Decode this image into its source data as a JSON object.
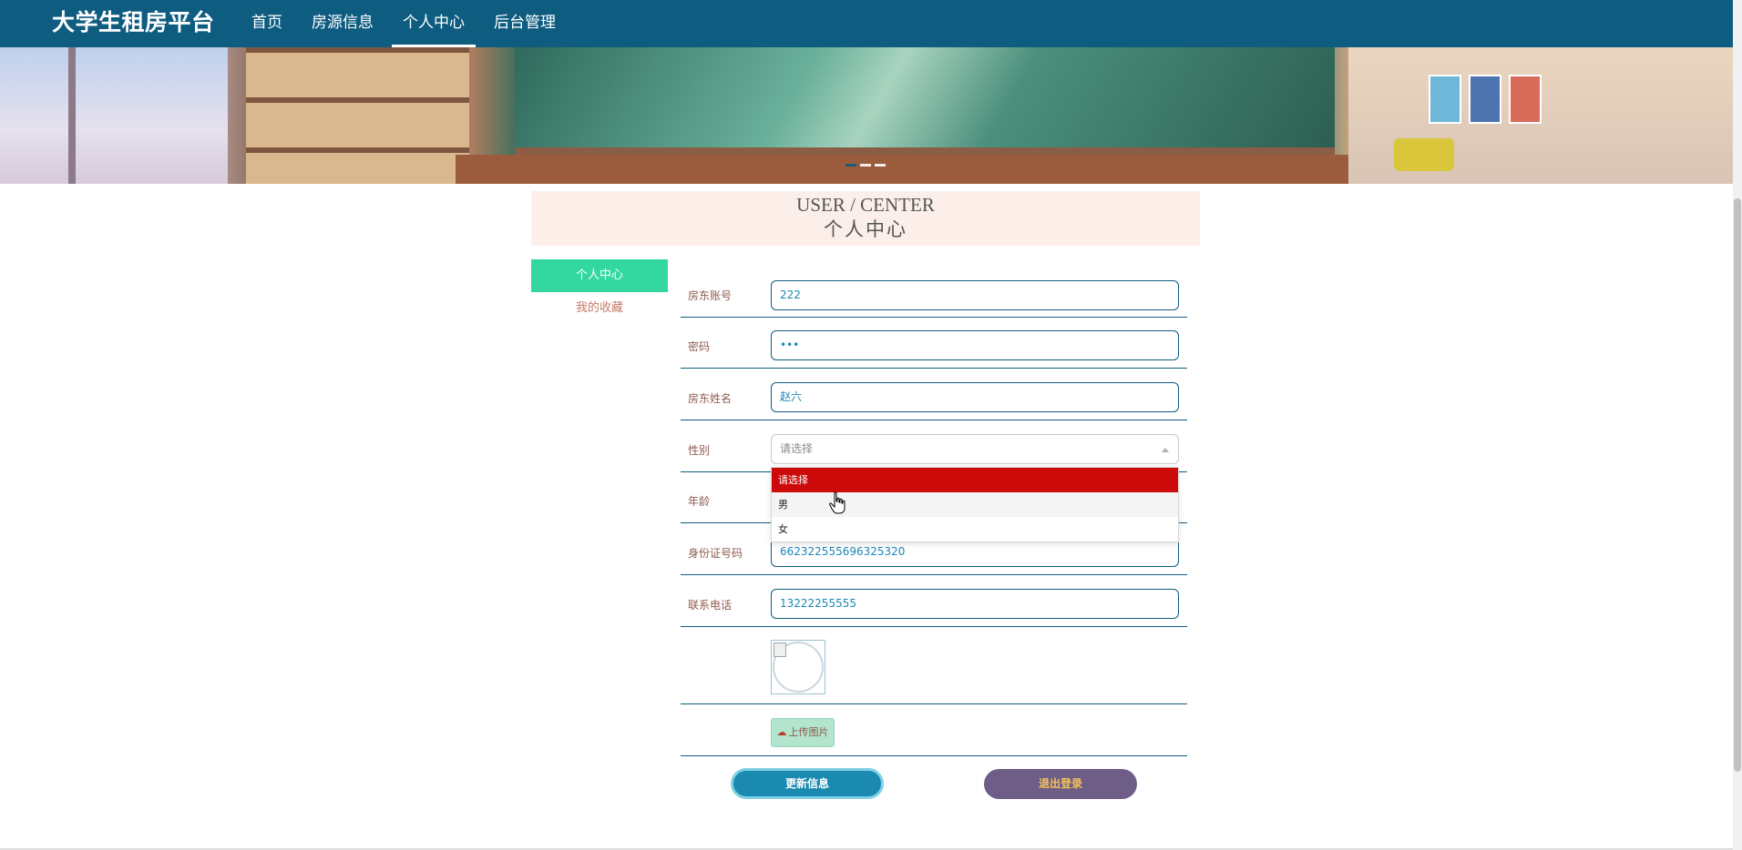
{
  "nav": {
    "brand": "大学生租房平台",
    "items": [
      {
        "label": "首页"
      },
      {
        "label": "房源信息"
      },
      {
        "label": "个人中心"
      },
      {
        "label": "后台管理"
      }
    ],
    "active_item": "个人中心",
    "bg_color": "#0e5c80"
  },
  "banner": {
    "slides_count": 3,
    "active_slide": 1
  },
  "header": {
    "title_en": "USER / CENTER",
    "title_cn": "个人中心"
  },
  "side_menu": {
    "items": [
      {
        "label": "个人中心"
      },
      {
        "label": "我的收藏"
      }
    ],
    "active_color": "#33d8a0"
  },
  "form": {
    "account": {
      "label": "房东账号",
      "value": "222"
    },
    "password": {
      "label": "密码",
      "value": "•••"
    },
    "name": {
      "label": "房东姓名",
      "value": "赵六"
    },
    "gender": {
      "label": "性别",
      "placeholder": "请选择",
      "options": [
        "请选择",
        "男",
        "女"
      ],
      "highlighted_option": "请选择"
    },
    "age": {
      "label": "年龄",
      "value": ""
    },
    "id_number": {
      "label": "身份证号码",
      "value": "662322555696325320"
    },
    "phone": {
      "label": "联系电话",
      "value": "13222255555"
    },
    "upload_label": "上传图片",
    "update_button": "更新信息",
    "logout_button": "退出登录"
  },
  "colors": {
    "accent": "#0e5c80",
    "update_button": "#1b8ab0",
    "logout_button": "#6e5d86",
    "selected_option": "#cc0a0a"
  }
}
